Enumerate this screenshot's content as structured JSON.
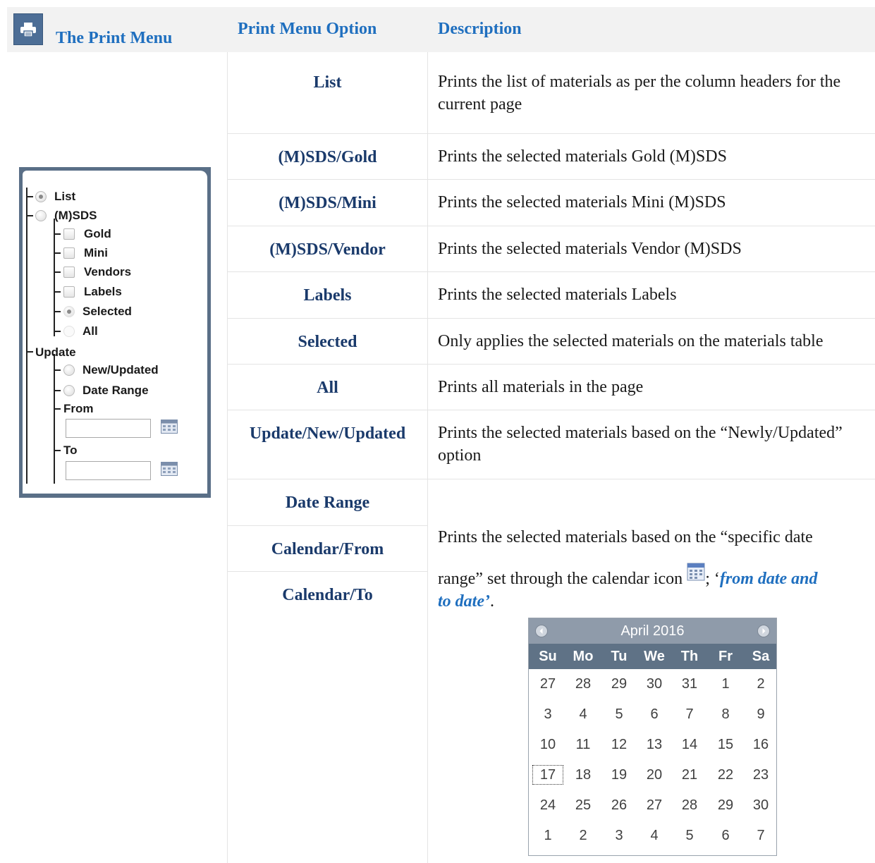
{
  "header": {
    "print_menu_title": "The Print  Menu",
    "col_option": "Print Menu Option",
    "col_description": "Description"
  },
  "rows": [
    {
      "option": "List",
      "description": "Prints the list of materials as per the column headers for the current page"
    },
    {
      "option": "(M)SDS/Gold",
      "description": "Prints the selected materials Gold (M)SDS"
    },
    {
      "option": "(M)SDS/Mini",
      "description": "Prints the selected materials Mini (M)SDS"
    },
    {
      "option": "(M)SDS/Vendor",
      "description": "Prints the selected materials Vendor (M)SDS"
    },
    {
      "option": "Labels",
      "description": "Prints the selected materials Labels"
    },
    {
      "option": "Selected",
      "description": "Only applies the selected materials on the materials table"
    },
    {
      "option": "All",
      "description": "Prints all materials in the page"
    },
    {
      "option": "Update/New/Updated",
      "description": "Prints the selected materials based on the “Newly/Updated” option"
    }
  ],
  "date_rows": {
    "options": [
      "Date Range",
      "Calendar/From",
      "Calendar/To"
    ],
    "desc_part1": "Prints the selected materials based on the “specific date",
    "desc_part2": "range” set through the calendar icon ",
    "desc_part3": "; ‘",
    "desc_emph_1": "from date and",
    "desc_emph_2": "to date’",
    "desc_end": "."
  },
  "panel": {
    "items": {
      "list": "List",
      "msds": "(M)SDS",
      "gold": "Gold",
      "mini": "Mini",
      "vendors": "Vendors",
      "labels": "Labels",
      "selected": "Selected",
      "all": "All",
      "update": "Update",
      "new_updated": "New/Updated",
      "date_range": "Date Range",
      "from": "From",
      "to": "To"
    },
    "from_value": "",
    "to_value": ""
  },
  "calendar": {
    "month_label": "April 2016",
    "weekdays": [
      "Su",
      "Mo",
      "Tu",
      "We",
      "Th",
      "Fr",
      "Sa"
    ],
    "weeks": [
      [
        "27",
        "28",
        "29",
        "30",
        "31",
        "1",
        "2"
      ],
      [
        "3",
        "4",
        "5",
        "6",
        "7",
        "8",
        "9"
      ],
      [
        "10",
        "11",
        "12",
        "13",
        "14",
        "15",
        "16"
      ],
      [
        "17",
        "18",
        "19",
        "20",
        "21",
        "22",
        "23"
      ],
      [
        "24",
        "25",
        "26",
        "27",
        "28",
        "29",
        "30"
      ],
      [
        "1",
        "2",
        "3",
        "4",
        "5",
        "6",
        "7"
      ]
    ],
    "today": "17"
  },
  "colors": {
    "header_blue": "#1f6fbf",
    "option_navy": "#1a3a6b",
    "calendar_title": "#8f9baa",
    "calendar_weekdays": "#5f7286",
    "panel_frame": "#5a6f87"
  }
}
